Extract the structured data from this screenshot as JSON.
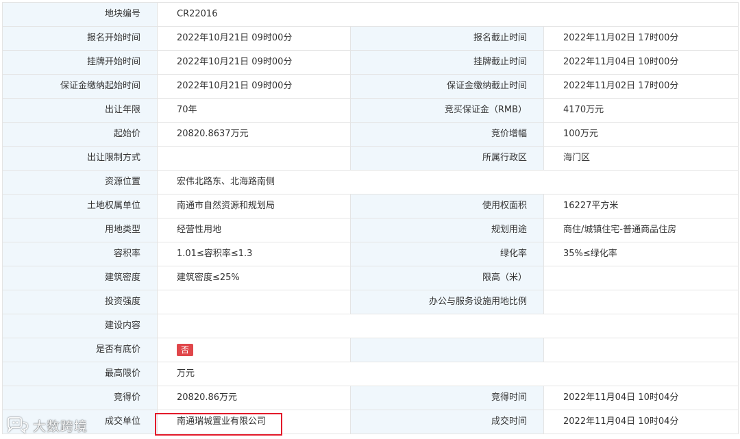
{
  "rows": [
    {
      "l1": "地块编号",
      "v1": "CR22016"
    },
    {
      "l1": "报名开始时间",
      "v1": "2022年10月21日 09时00分",
      "l2": "报名截止时间",
      "v2": "2022年11月02日 17时00分"
    },
    {
      "l1": "挂牌开始时间",
      "v1": "2022年10月21日 09时00分",
      "l2": "挂牌截止时间",
      "v2": "2022年11月04日 10时00分"
    },
    {
      "l1": "保证金缴纳起始时间",
      "v1": "2022年10月21日 09时00分",
      "l2": "保证金缴纳截止时间",
      "v2": "2022年11月02日 17时00分"
    },
    {
      "l1": "出让年限",
      "v1": "70年",
      "l2": "竞买保证金（RMB）",
      "v2": "4170万元"
    },
    {
      "l1": "起始价",
      "v1": "20820.8637万元",
      "l2": "竞价增幅",
      "v2": "100万元"
    },
    {
      "l1": "出让限制方式",
      "v1": "",
      "l2": "所属行政区",
      "v2": "海门区"
    },
    {
      "l1": "资源位置",
      "v1": "宏伟北路东、北海路南侧"
    },
    {
      "l1": "土地权属单位",
      "v1": "南通市自然资源和规划局",
      "l2": "使用权面积",
      "v2": "16227平方米"
    },
    {
      "l1": "用地类型",
      "v1": "经营性用地",
      "l2": "规划用途",
      "v2": "商住/城镇住宅-普通商品住房"
    },
    {
      "l1": "容积率",
      "v1": "1.01≤容积率≤1.3",
      "l2": "绿化率",
      "v2": "35%≤绿化率"
    },
    {
      "l1": "建筑密度",
      "v1": "建筑密度≤25%",
      "l2": "限高（米）",
      "v2": ""
    },
    {
      "l1": "投资强度",
      "v1": "",
      "l2": "办公与服务设施用地比例",
      "v2": ""
    },
    {
      "l1": "建设内容",
      "v1": ""
    },
    {
      "l1": "是否有底价",
      "badge": "否",
      "l2": "",
      "v2": ""
    },
    {
      "l1": "最高限价",
      "v1": "万元"
    },
    {
      "l1": "竞得价",
      "v1": "20820.86万元",
      "l2": "竞得时间",
      "v2": "2022年11月04日 10时04分"
    },
    {
      "l1": "成交单位",
      "v1": "南通瑞城置业有限公司",
      "l2": "成交时间",
      "v2": "2022年11月04日 10时04分"
    }
  ],
  "watermark": {
    "text": "大数跨境",
    "icon": "chat-bubble-logo-icon"
  },
  "colors": {
    "label_bg": "#f0f7fc",
    "border": "#e4e4e4",
    "badge": "#e0464a",
    "highlight": "#e3192a"
  }
}
